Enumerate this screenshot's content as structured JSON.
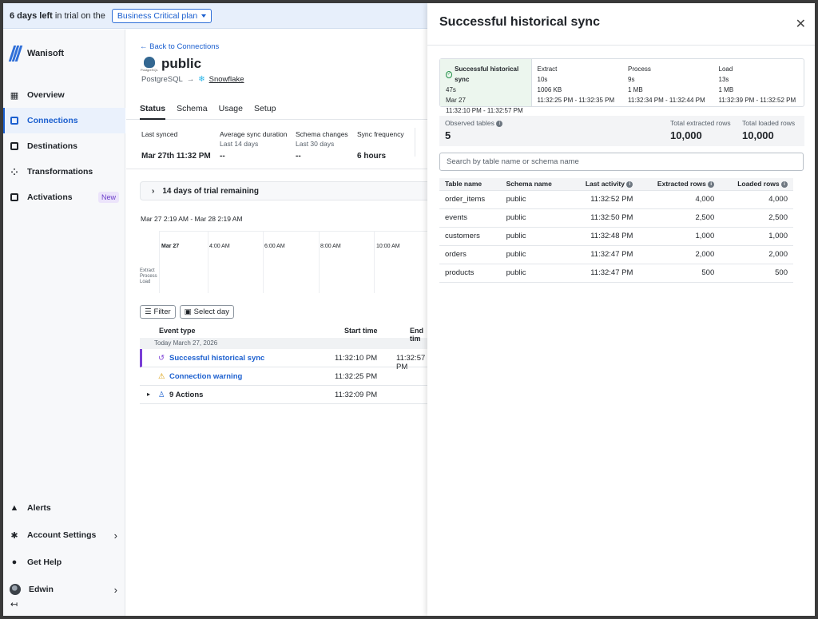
{
  "trial_banner": {
    "days_left": "6 days left",
    "rest": "in trial on the",
    "plan_label": "Business Critical plan"
  },
  "sidebar": {
    "brand": "Wanisoft",
    "items": [
      {
        "label": "Overview",
        "icon": "grid-icon"
      },
      {
        "label": "Connections",
        "icon": "plug-icon"
      },
      {
        "label": "Destinations",
        "icon": "destination-icon"
      },
      {
        "label": "Transformations",
        "icon": "nodes-icon"
      },
      {
        "label": "Activations",
        "icon": "activation-icon",
        "badge": "New"
      }
    ],
    "bottom": [
      {
        "label": "Alerts",
        "icon": "warning-icon"
      },
      {
        "label": "Account Settings",
        "icon": "gear-icon"
      },
      {
        "label": "Get Help",
        "icon": "info-icon"
      },
      {
        "label": "Edwin",
        "icon": "avatar"
      }
    ]
  },
  "main": {
    "back_link": "← Back to Connections",
    "title": "public",
    "pg_logo_text": "PostgreSQL",
    "source": "PostgreSQL",
    "destination": "Snowflake",
    "tabs": [
      "Status",
      "Schema",
      "Usage",
      "Setup"
    ],
    "stats": [
      {
        "label": "Last synced",
        "sub": "",
        "value": "Mar 27th 11:32 PM"
      },
      {
        "label": "Average sync duration",
        "sub": "Last 14 days",
        "value": "--"
      },
      {
        "label": "Schema changes",
        "sub": "Last 30 days",
        "value": "--"
      },
      {
        "label": "Sync frequency",
        "sub": "",
        "value": "6 hours"
      }
    ],
    "trial_panel": "14 days of trial remaining",
    "range": "Mar 27 2:19 AM - Mar 28 2:19 AM",
    "timeline": {
      "times": [
        "Mar 27",
        "4:00 AM",
        "6:00 AM",
        "8:00 AM",
        "10:00 AM"
      ],
      "rows": [
        "Extract",
        "Process",
        "Load"
      ]
    },
    "filter_label": "Filter",
    "select_day_label": "Select day",
    "events": {
      "headers": {
        "type": "Event type",
        "start": "Start time",
        "end": "End tim"
      },
      "day": "Today March 27, 2026",
      "rows": [
        {
          "type": "Successful historical sync",
          "start": "11:32:10 PM",
          "end": "11:32:57 PM"
        },
        {
          "type": "Connection warning",
          "start": "11:32:25 PM",
          "end": ""
        },
        {
          "type": "9 Actions",
          "start": "11:32:09 PM",
          "end": ""
        }
      ]
    }
  },
  "drawer": {
    "title": "Successful historical sync",
    "steps": [
      {
        "name": "Successful historical sync",
        "duration": "47s",
        "detail": "Mar 27",
        "range": "11:32:10 PM - 11:32:57 PM"
      },
      {
        "name": "Extract",
        "duration": "10s",
        "detail": "1006 KB",
        "range": "11:32:25 PM - 11:32:35 PM"
      },
      {
        "name": "Process",
        "duration": "9s",
        "detail": "1 MB",
        "range": "11:32:34 PM - 11:32:44 PM"
      },
      {
        "name": "Load",
        "duration": "13s",
        "detail": "1 MB",
        "range": "11:32:39 PM - 11:32:52 PM"
      }
    ],
    "summary": {
      "observed_label": "Observed tables",
      "observed_value": "5",
      "extracted_label": "Total extracted rows",
      "extracted_value": "10,000",
      "loaded_label": "Total loaded rows",
      "loaded_value": "10,000"
    },
    "search_placeholder": "Search by table name or schema name",
    "table": {
      "headers": [
        "Table name",
        "Schema name",
        "Last activity",
        "Extracted rows",
        "Loaded rows"
      ],
      "rows": [
        [
          "order_items",
          "public",
          "11:32:52 PM",
          "4,000",
          "4,000"
        ],
        [
          "events",
          "public",
          "11:32:50 PM",
          "2,500",
          "2,500"
        ],
        [
          "customers",
          "public",
          "11:32:48 PM",
          "1,000",
          "1,000"
        ],
        [
          "orders",
          "public",
          "11:32:47 PM",
          "2,000",
          "2,000"
        ],
        [
          "products",
          "public",
          "11:32:47 PM",
          "500",
          "500"
        ]
      ]
    }
  },
  "colors": {
    "accent": "#1b5fcf",
    "success_bg": "#ecf6ee",
    "selected_event": "#7a3ed6"
  }
}
